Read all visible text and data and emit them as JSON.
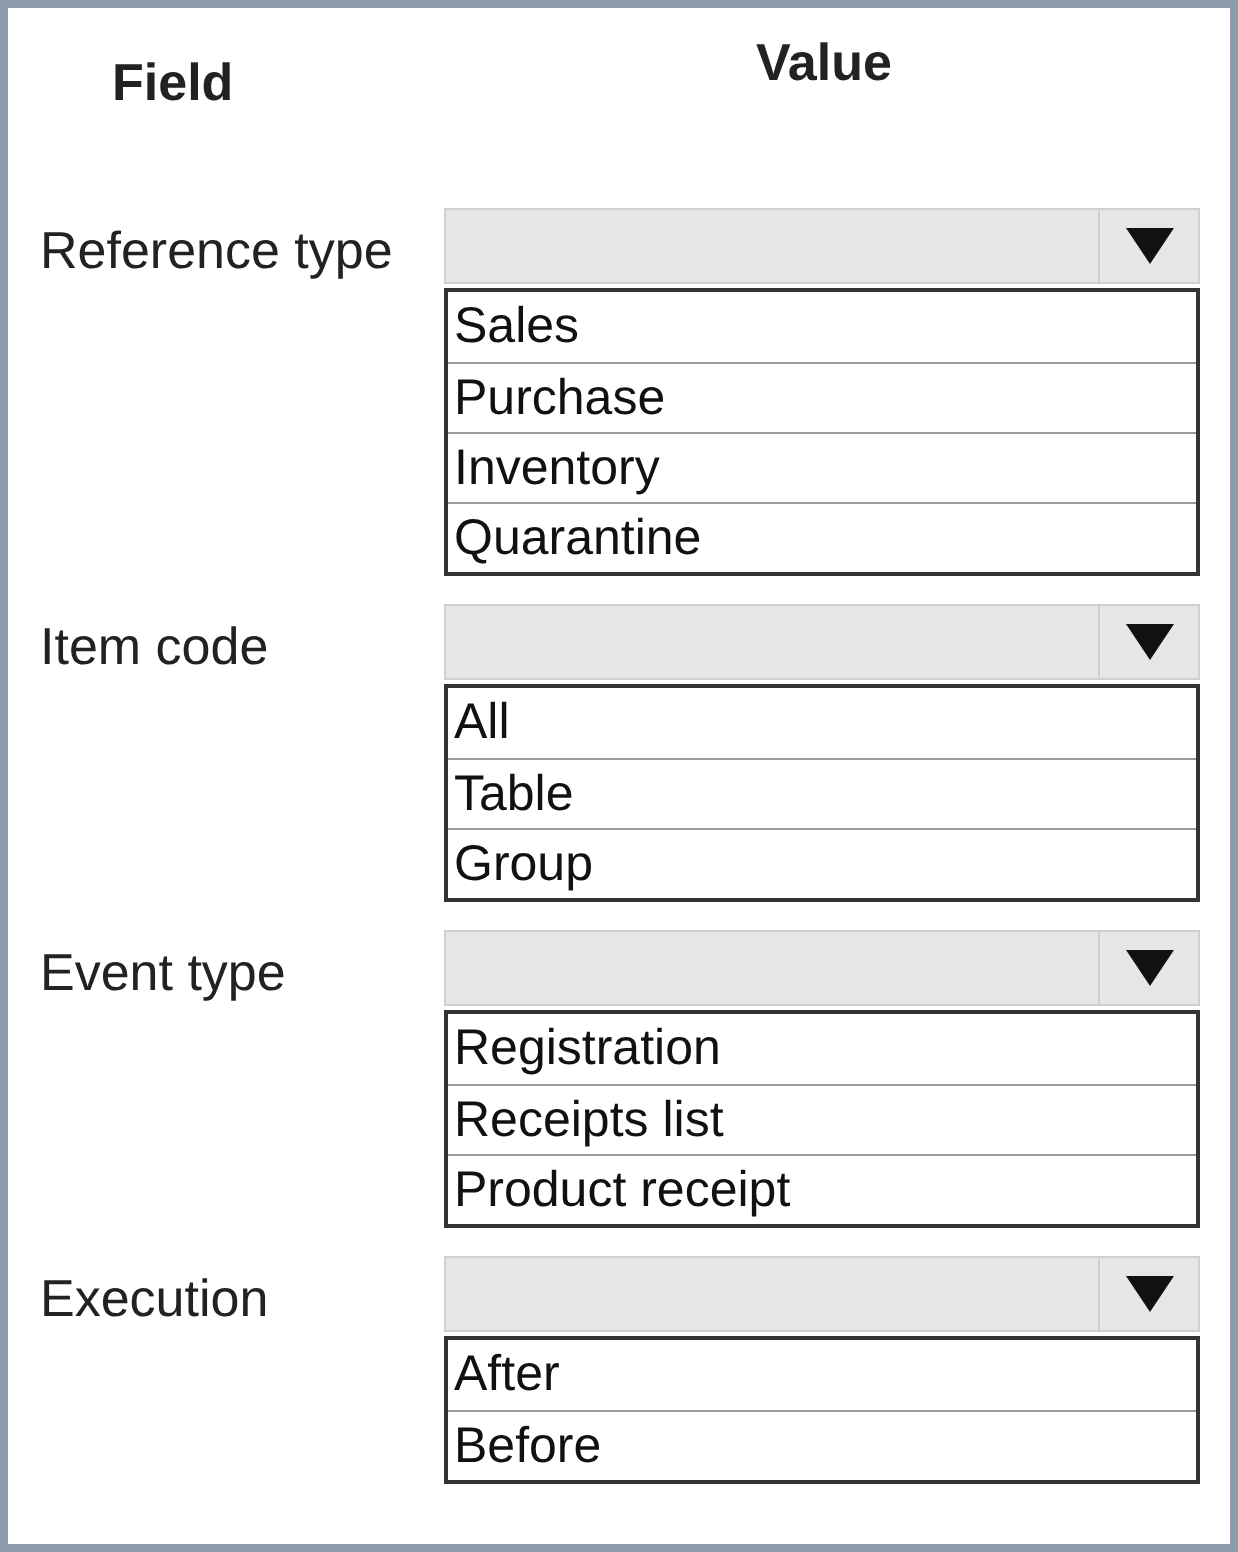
{
  "headers": {
    "field": "Field",
    "value": "Value"
  },
  "fields": [
    {
      "label": "Reference type",
      "options": [
        "Sales",
        "Purchase",
        "Inventory",
        "Quarantine"
      ]
    },
    {
      "label": "Item code",
      "options": [
        "All",
        "Table",
        "Group"
      ]
    },
    {
      "label": "Event type",
      "options": [
        "Registration",
        "Receipts list",
        "Product receipt"
      ]
    },
    {
      "label": "Execution",
      "options": [
        "After",
        "Before"
      ]
    }
  ]
}
